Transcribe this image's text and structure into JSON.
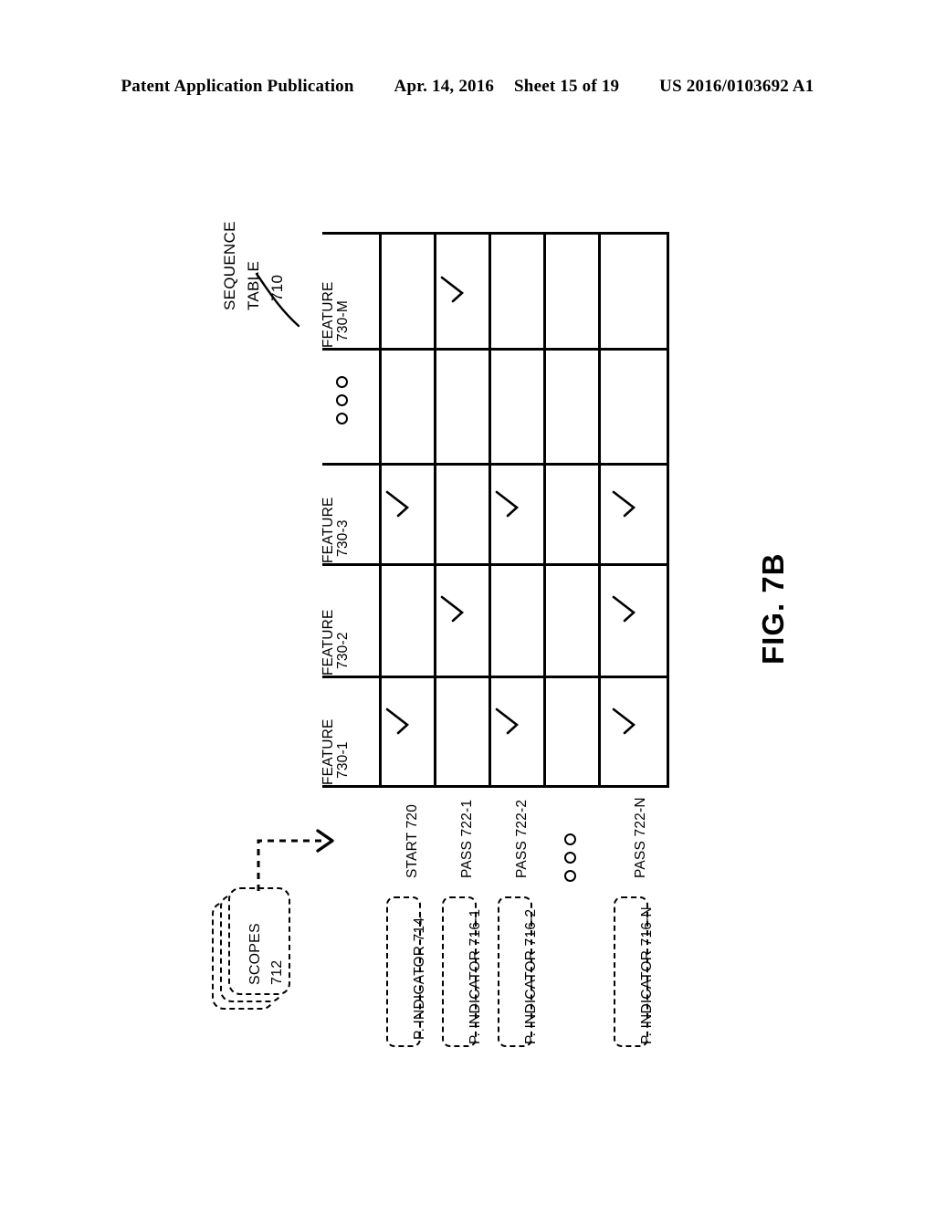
{
  "header": {
    "publication": "Patent Application Publication",
    "date": "Apr. 14, 2016",
    "sheet": "Sheet 15 of 19",
    "docnum": "US 2016/0103692 A1"
  },
  "figure": {
    "label": "FIG. 7B",
    "title_line1": "SEQUENCE",
    "title_line2": "TABLE",
    "title_ref": "710"
  },
  "scopes": {
    "line1": "SCOPES",
    "line2": "712"
  },
  "table": {
    "columns": [
      {
        "id": "c0",
        "line1": "FEATURE",
        "line2": "730-1",
        "ellipsis": false
      },
      {
        "id": "c1",
        "line1": "FEATURE",
        "line2": "730-2",
        "ellipsis": false
      },
      {
        "id": "c2",
        "line1": "FEATURE",
        "line2": "730-3",
        "ellipsis": false
      },
      {
        "id": "c3",
        "line1": "",
        "line2": "",
        "ellipsis": true
      },
      {
        "id": "c4",
        "line1": "FEATURE",
        "line2": "730-M",
        "ellipsis": false
      }
    ],
    "rows": [
      {
        "id": "r0",
        "label": "START 720",
        "ellipsis": false,
        "indicator": "P. INDICATOR 714"
      },
      {
        "id": "r1",
        "label": "PASS 722-1",
        "ellipsis": false,
        "indicator": "P. INDICATOR 716-1"
      },
      {
        "id": "r2",
        "label": "PASS 722-2",
        "ellipsis": false,
        "indicator": "P. INDICATOR 716-2"
      },
      {
        "id": "r3",
        "label": "",
        "ellipsis": true,
        "indicator": ""
      },
      {
        "id": "r4",
        "label": "PASS 722-N",
        "ellipsis": false,
        "indicator": "P. INDICATOR 716-N"
      }
    ],
    "marks": [
      {
        "row": 0,
        "col": 0
      },
      {
        "row": 0,
        "col": 2
      },
      {
        "row": 1,
        "col": 1
      },
      {
        "row": 1,
        "col": 4
      },
      {
        "row": 2,
        "col": 0
      },
      {
        "row": 2,
        "col": 2
      },
      {
        "row": 4,
        "col": 0
      },
      {
        "row": 4,
        "col": 1
      },
      {
        "row": 4,
        "col": 2
      }
    ],
    "mark_symbol": "checkmark"
  },
  "colors": {
    "ink": "#000000",
    "paper": "#ffffff"
  }
}
